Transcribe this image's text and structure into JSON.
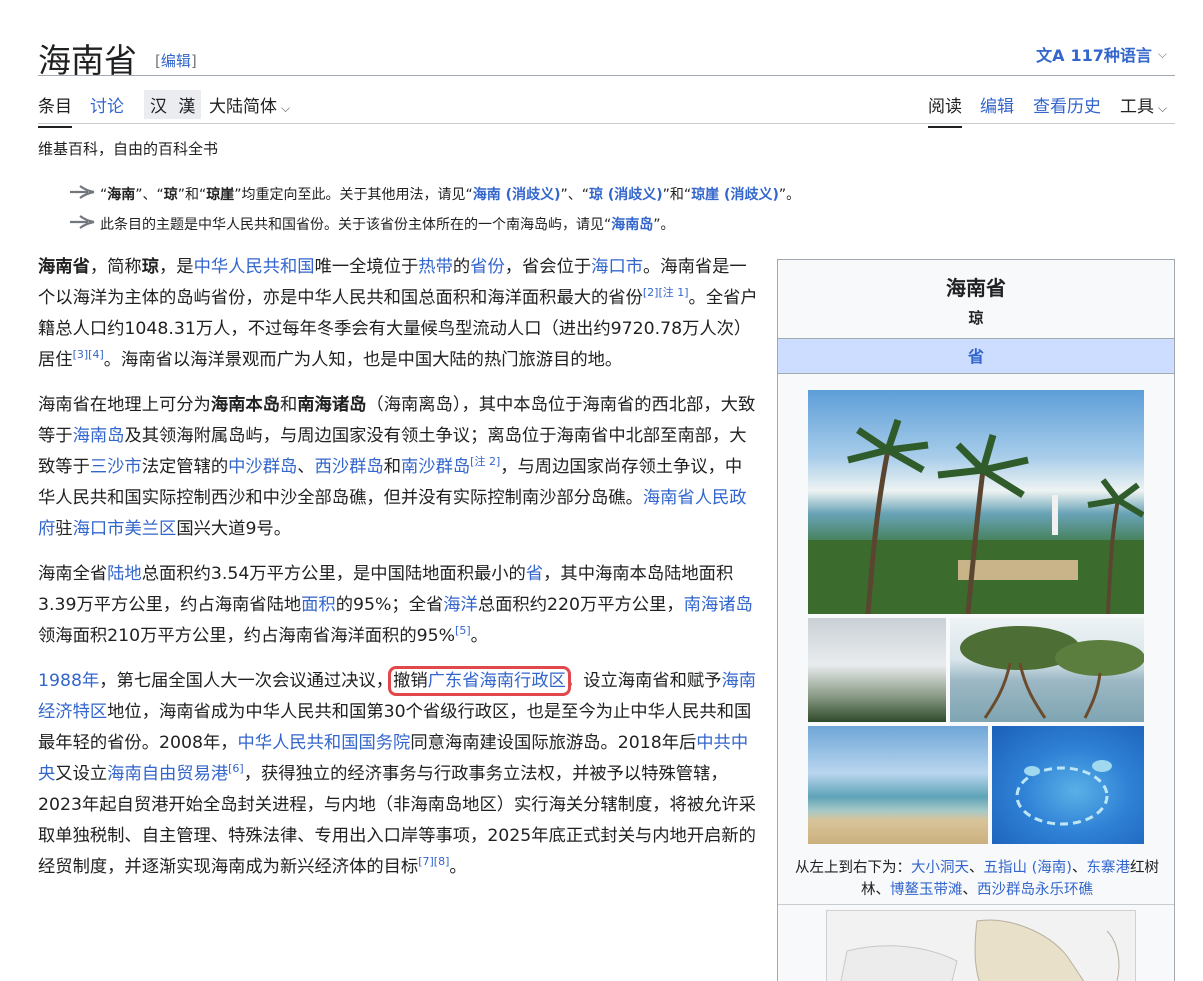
{
  "header": {
    "title": "海南省",
    "edit_label": "编辑",
    "languages": "117种语言"
  },
  "tabs": {
    "article": "条目",
    "talk": "讨论",
    "variant_1": "汉",
    "variant_2": "漢",
    "region": "大陆简体",
    "read": "阅读",
    "edit": "编辑",
    "history": "查看历史",
    "tools": "工具"
  },
  "tagline": "维基百科，自由的百科全书",
  "hatnotes": {
    "h1": {
      "t1": "“",
      "b1": "海南",
      "t2": "”、“",
      "b2": "琼",
      "t3": "”和“",
      "b3": "琼崖",
      "t4": "”均重定向至此。关于其他用法，请见“",
      "l1": "海南 (消歧义)",
      "t5": "”、“",
      "l2": "琼 (消歧义)",
      "t6": "”和“",
      "l3": "琼崖 (消歧义)",
      "t7": "”。"
    },
    "h2": {
      "t1": "此条目的主题是中华人民共和国省份。关于该省份主体所在的一个南海岛屿，请见“",
      "l1": "海南岛",
      "t2": "”。"
    }
  },
  "paragraphs": {
    "p1": {
      "b1": "海南省",
      "t1": "，简称",
      "b2": "琼",
      "t2": "，是",
      "l1": "中华人民共和国",
      "t3": "唯一全境位于",
      "l2": "热带",
      "t4": "的",
      "l3": "省份",
      "t5": "，省会位于",
      "l4": "海口市",
      "t6": "。海南省是一个以海洋为主体的岛屿省份，亦是中华人民共和国总面积和海洋面积最大的省份",
      "r1": "[2]",
      "r2": "[注 1]",
      "t7": "。全省户籍总人口约1048.31万人，不过每年冬季会有大量候鸟型流动人口（进出约9720.78万人次）居住",
      "r3": "[3]",
      "r4": "[4]",
      "t8": "。海南省以海洋景观而广为人知，也是中国大陆的热门旅游目的地。"
    },
    "p2": {
      "t1": "海南省在地理上可分为",
      "b1": "海南本岛",
      "t2": "和",
      "b2": "南海诸岛",
      "t3": "（海南离岛），其中本岛位于海南省的西北部，大致等于",
      "l1": "海南岛",
      "t4": "及其领海附属岛屿，与周边国家没有领土争议；离岛位于海南省中北部至南部，大致等于",
      "l2": "三沙市",
      "t5": "法定管辖的",
      "l3": "中沙群岛",
      "t6": "、",
      "l4": "西沙群岛",
      "t7": "和",
      "l5": "南沙群岛",
      "r1": "[注 2]",
      "t8": "，与周边国家尚存领土争议，中华人民共和国实际控制西沙和中沙全部岛礁，但并没有实际控制南沙部分岛礁。",
      "l6": "海南省人民政府",
      "t9": "驻",
      "l7": "海口市",
      "l8": "美兰区",
      "t10": "国兴大道9号。"
    },
    "p3": {
      "t1": "海南全省",
      "l1": "陆地",
      "t2": "总面积约3.54万平方公里，是中国陆地面积最小的",
      "l2": "省",
      "t3": "，其中海南本岛陆地面积3.39万平方公里，约占海南省陆地",
      "l3": "面积",
      "t4": "的95%；全省",
      "l4": "海洋",
      "t5": "总面积约220万平方公里，",
      "l5": "南海诸岛",
      "t6": "领海面积210万平方公里，约占海南省海洋面积的95%",
      "r1": "[5]",
      "t7": "。"
    },
    "p4": {
      "l1": "1988年",
      "t1": "，第七届全国人大一次会议通过决议，",
      "t2": "撤销",
      "l2": "广东省海南行政区",
      "t3": "，设立海南省和赋予",
      "l3": "海南经济特区",
      "t4": "地位，海南省成为中华人民共和国第30个省级行政区，也是至今为止中华人民共和国最年轻的省份。2008年，",
      "l4": "中华人民共和国国务院",
      "t5": "同意海南建设国际旅游岛。2018年后",
      "l5": "中共中央",
      "t6": "又设立",
      "l6": "海南自由贸易港",
      "r1": "[6]",
      "t7": "，获得独立的经济事务与行政事务立法权，并被予以特殊管辖，2023年起自贸港开始全岛封关进程，与内地（非海南岛地区）实行海关分辖制度，将被允许采取单独税制、自主管理、特殊法律、专用出入口岸等事项，2025年底正式封关与内地开启新的经贸制度，并逐渐实现海南成为新兴经济体的目标",
      "r2": "[7]",
      "r3": "[8]",
      "t8": "。"
    }
  },
  "infobox": {
    "title": "海南省",
    "subtitle": "琼",
    "type": "省",
    "caption": {
      "t1": "从左上到右下为：",
      "l1": "大小洞天",
      "t2": "、",
      "l2": "五指山 (海南)",
      "t3": "、",
      "l3": "东寨港",
      "t4": "红树林、",
      "l4": "博鳌玉带滩",
      "t5": "、",
      "l5": "西沙群岛永乐环礁"
    }
  },
  "colors": {
    "link": "#3366cc",
    "highlight": "#e0484c",
    "infobox_header": "#ccddff"
  }
}
